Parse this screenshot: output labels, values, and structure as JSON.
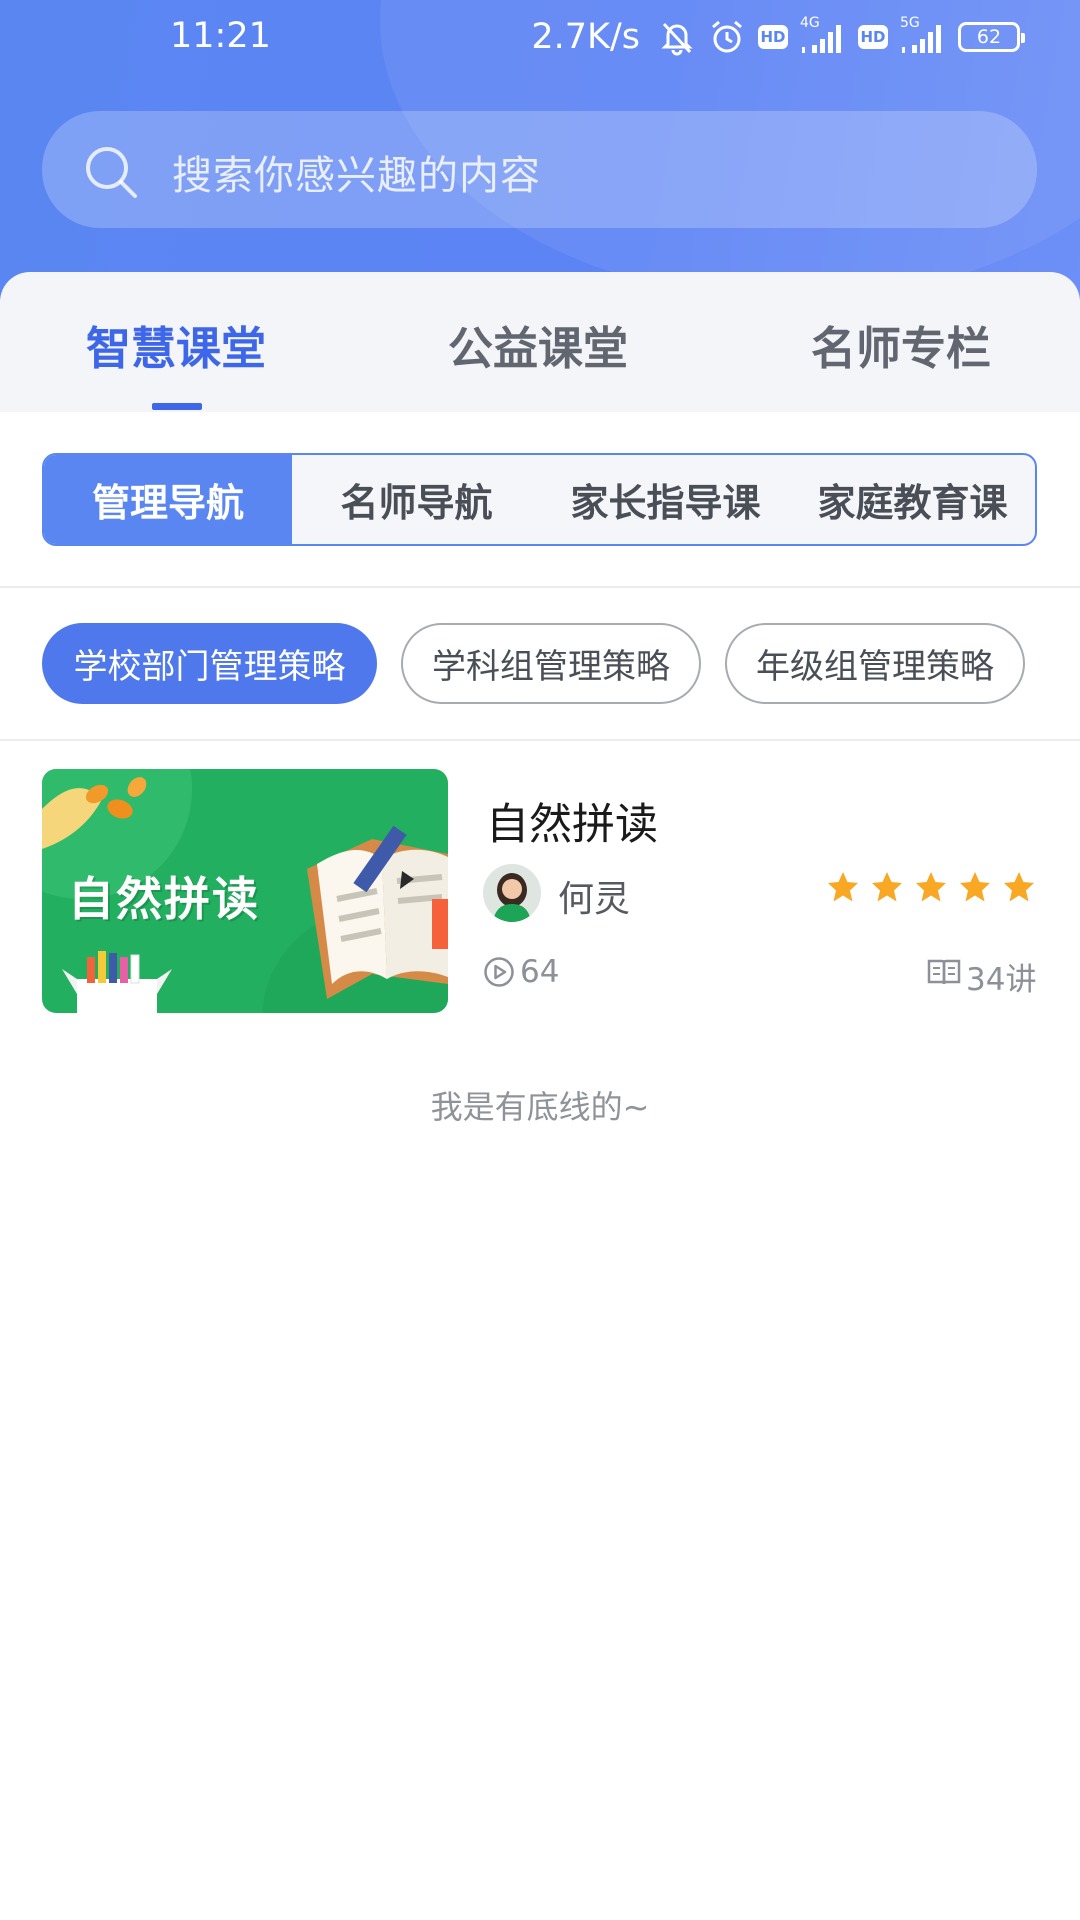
{
  "status_bar": {
    "time": "11:21",
    "net_speed": "2.7K/s",
    "hd1": "HD",
    "network1": "4G",
    "hd2": "HD",
    "network2": "5G",
    "battery": "62"
  },
  "search": {
    "placeholder": "搜索你感兴趣的内容"
  },
  "main_tabs": [
    {
      "label": "智慧课堂",
      "active": true
    },
    {
      "label": "公益课堂",
      "active": false
    },
    {
      "label": "名师专栏",
      "active": false
    }
  ],
  "segments": [
    {
      "label": "管理导航",
      "active": true
    },
    {
      "label": "名师导航",
      "active": false
    },
    {
      "label": "家长指导课",
      "active": false
    },
    {
      "label": "家庭教育课",
      "active": false
    }
  ],
  "chips": [
    {
      "label": "学校部门管理策略",
      "active": true
    },
    {
      "label": "学科组管理策略",
      "active": false
    },
    {
      "label": "年级组管理策略",
      "active": false
    }
  ],
  "courses": [
    {
      "thumb_text": "自然拼读",
      "title": "自然拼读",
      "teacher": "何灵",
      "rating": 5,
      "plays": "64",
      "lessons": "34讲"
    }
  ],
  "footer_note": "我是有底线的~",
  "colors": {
    "brand_blue": "#5a86f2",
    "tab_active": "#3d67e8",
    "star": "#f9a825",
    "thumb_green": "#22b060"
  }
}
